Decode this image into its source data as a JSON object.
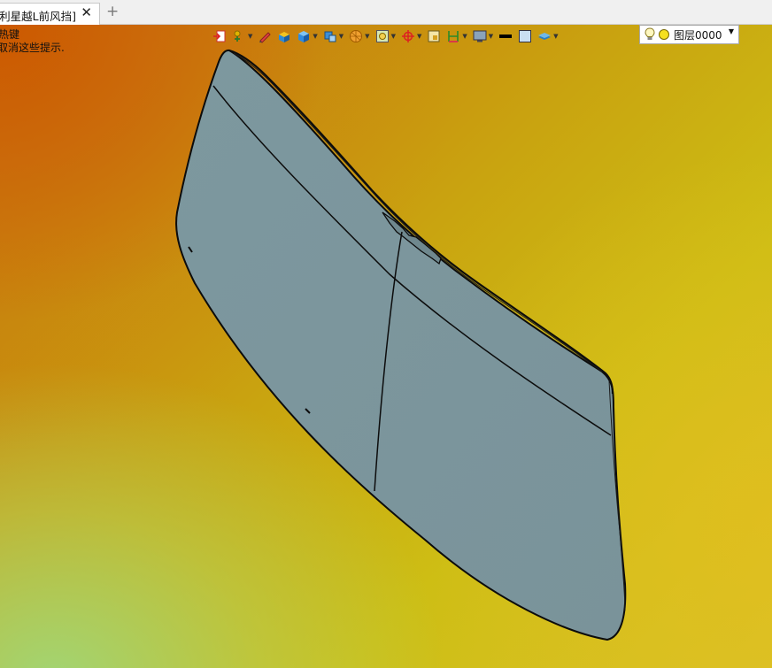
{
  "tab": {
    "title": "吉利星越L前风挡]",
    "close": "✕",
    "add": "+"
  },
  "hint": {
    "line1": "热键",
    "line2": "取消这些提示."
  },
  "toolbar": {
    "icons": [
      "import-icon",
      "point-tool-icon",
      "pen-icon",
      "box-solid-icon",
      "cube-icon",
      "view-cube-icon",
      "sphere-icon",
      "zoom-fit-icon",
      "origin-icon",
      "frame-icon",
      "dimension-icon",
      "monitor-icon",
      "line-color-icon",
      "fill-color-icon",
      "layer-stack-icon"
    ],
    "layer": {
      "name": "图层0000",
      "bulb": "💡"
    }
  },
  "colors": {
    "glass_fill": "#7b959c",
    "glass_stroke": "#0c0c0c",
    "tabbar_bg": "#f0f0f0"
  }
}
